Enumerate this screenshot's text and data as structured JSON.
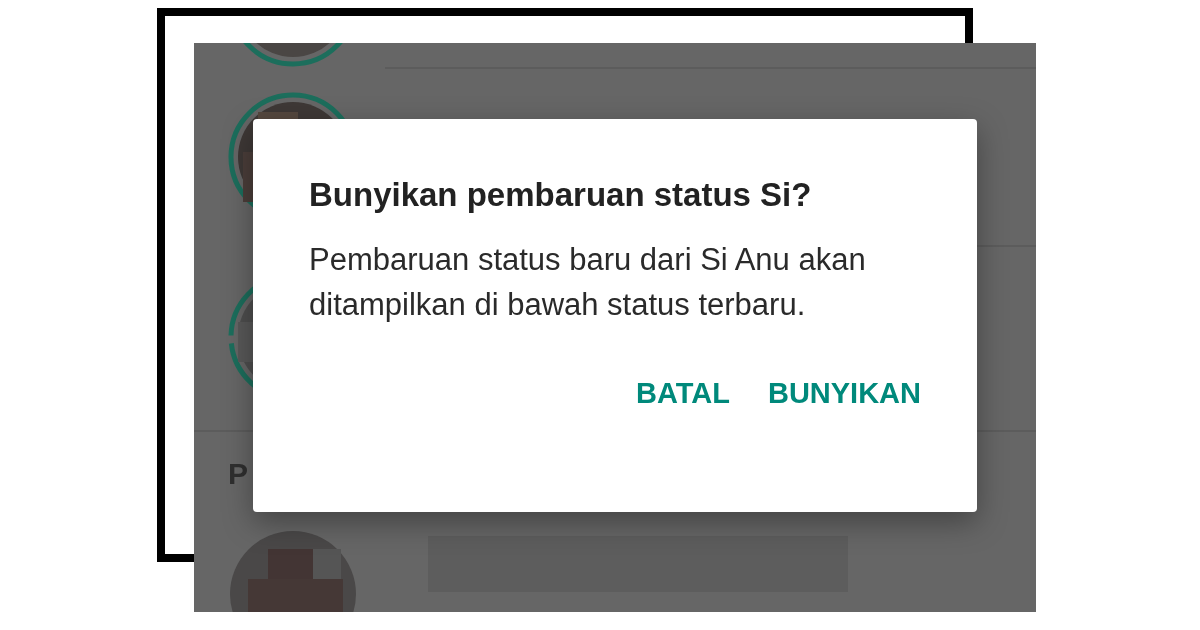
{
  "background_list": {
    "section_header": "P"
  },
  "dialog": {
    "title": "Bunyikan pembaruan status Si?",
    "message": "Pembaruan status baru dari Si Anu akan ditampilkan di bawah status terbaru.",
    "buttons": [
      {
        "label": "BATAL"
      },
      {
        "label": "BUNYIKAN"
      }
    ]
  }
}
